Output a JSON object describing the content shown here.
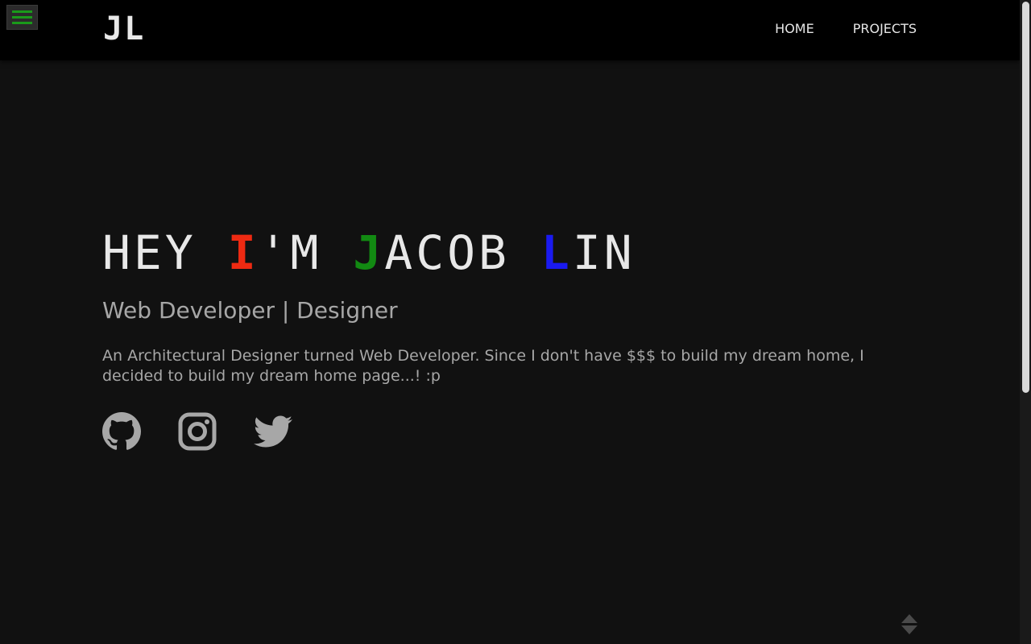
{
  "navbar": {
    "menu_icon": "hamburger-icon",
    "logo": "JL",
    "links": [
      "HOME",
      "PROJECTS"
    ],
    "menu_color": "#1a9a1a"
  },
  "hero": {
    "headline_parts": [
      "HEY ",
      "I",
      "'M ",
      "J",
      "ACOB ",
      "L",
      "IN"
    ],
    "subtitle": "Web Developer | Designer",
    "bio": "An Architectural Designer turned Web Developer. Since I don't have $$$ to build my dream home, I decided to build my dream home page...! :p",
    "accent_colors": {
      "red": "#ee2a12",
      "green": "#128a12",
      "blue": "#1a1af0"
    }
  },
  "socials": [
    "github-icon",
    "instagram-icon",
    "twitter-icon"
  ],
  "scroll_icon": "scroll-up-down-icon"
}
